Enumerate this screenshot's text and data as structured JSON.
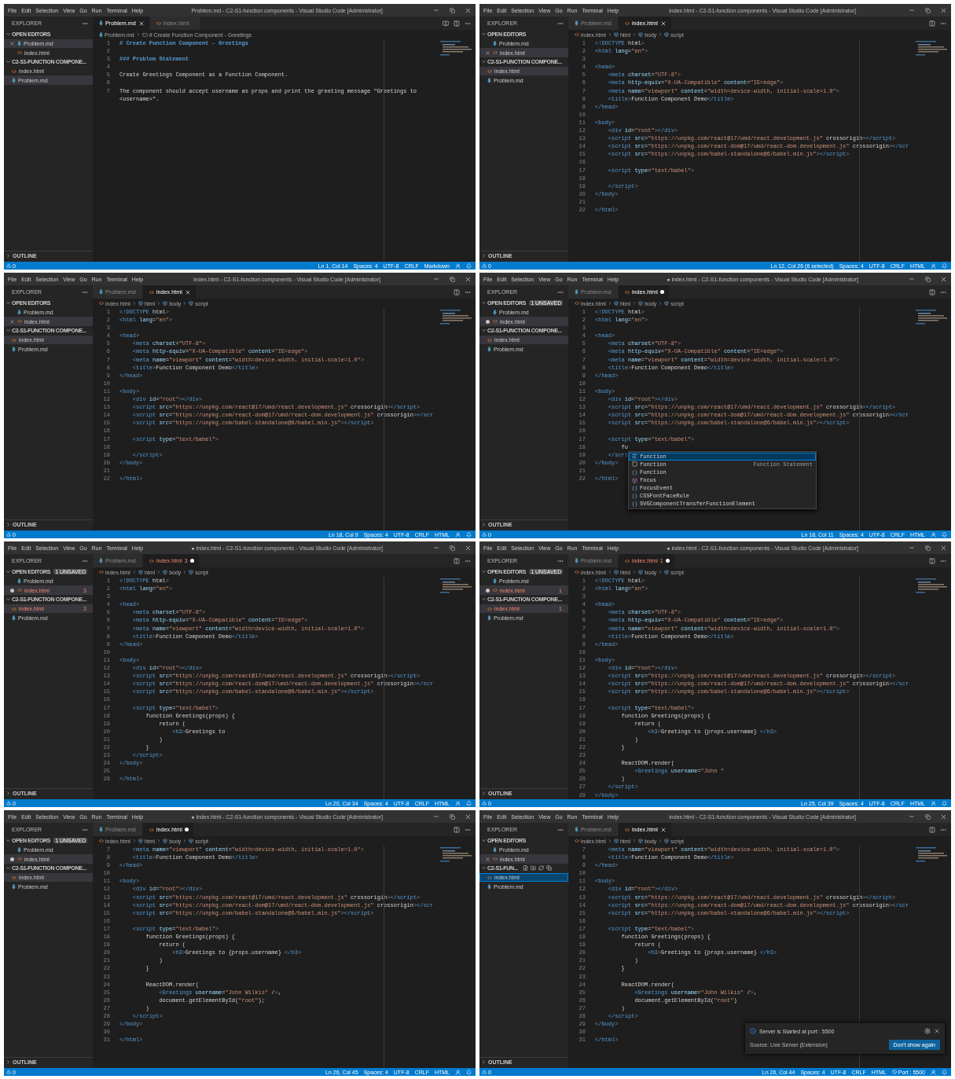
{
  "panels": [
    {
      "title": "Problem.md - C2-S1-function components - Visual Studio Code [Administrator]",
      "menu": [
        "File",
        "Edit",
        "Selection",
        "View",
        "Go",
        "Run",
        "Terminal",
        "Help"
      ],
      "explorer": {
        "heading": "EXPLORER",
        "open_editors": {
          "heading": "OPEN EDITORS",
          "items": [
            {
              "name": "Problem.md",
              "kind": "markdown",
              "selected": true,
              "dirty": false
            },
            {
              "name": "index.html",
              "kind": "html",
              "selected": false,
              "dirty": false
            }
          ]
        },
        "folder": {
          "heading": "C2-S1-FUNCTION COMPONE...",
          "focused": false,
          "files": [
            {
              "name": "index.html",
              "kind": "html",
              "selected": false
            },
            {
              "name": "Problem.md",
              "kind": "markdown",
              "selected": true
            }
          ]
        },
        "outline": "OUTLINE"
      },
      "tabs": [
        {
          "label": "Problem.md",
          "kind": "markdown",
          "selected": true,
          "dirty": false
        },
        {
          "label": "index.html",
          "kind": "html",
          "selected": false,
          "dirty": false
        }
      ],
      "breadcrumb": [
        {
          "label": "Problem.md",
          "kind": "markdown"
        },
        {
          "label": "# Create Function Component - Greetings",
          "kind": "heading"
        }
      ],
      "kind": "markdown",
      "lines": [
        {
          "n": "1",
          "code": "# Create Function Component - Greetings",
          "kind": "heading"
        },
        {
          "n": "2"
        },
        {
          "n": "3",
          "code": "### Problem Statement",
          "kind": "heading"
        },
        {
          "n": "4"
        },
        {
          "n": "5",
          "code": "Create Greetings Component as a Function Component.",
          "kind": "text"
        },
        {
          "n": "6"
        },
        {
          "n": "7",
          "code": "The component should accept username as props and print the greeting message \"Greetings to <username>\".",
          "kind": "text"
        }
      ],
      "status": {
        "problems": "0",
        "items": [
          {
            "text": "Ln 1, Col 14",
            "kind": "text"
          },
          {
            "text": "Spaces: 4",
            "kind": "text"
          },
          {
            "text": "UTF-8",
            "kind": "text"
          },
          {
            "text": "CRLF",
            "kind": "text"
          },
          {
            "text": "Markdown",
            "kind": "text"
          }
        ]
      }
    },
    {
      "title": "index.html - C2-S1-function components - Visual Studio Code [Administrator]",
      "menu": [
        "File",
        "Edit",
        "Selection",
        "View",
        "Go",
        "Run",
        "Terminal",
        "Help"
      ],
      "explorer": {
        "heading": "EXPLORER",
        "open_editors": {
          "heading": "OPEN EDITORS",
          "items": [
            {
              "name": "Problem.md",
              "kind": "markdown",
              "selected": false,
              "dirty": false
            },
            {
              "name": "index.html",
              "kind": "html",
              "selected": true,
              "dirty": false
            }
          ]
        },
        "folder": {
          "heading": "C2-S1-FUNCTION COMPONE...",
          "focused": false,
          "files": [
            {
              "name": "index.html",
              "kind": "html",
              "selected": true
            },
            {
              "name": "Problem.md",
              "kind": "markdown",
              "selected": false
            }
          ]
        },
        "outline": "OUTLINE"
      },
      "tabs": [
        {
          "label": "Problem.md",
          "kind": "markdown",
          "selected": false,
          "dirty": false
        },
        {
          "label": "index.html",
          "kind": "html",
          "selected": true,
          "dirty": false
        }
      ],
      "breadcrumb": [
        {
          "label": "index.html",
          "kind": "html"
        },
        {
          "label": "html",
          "kind": "element"
        },
        {
          "label": "body",
          "kind": "element"
        },
        {
          "label": "script",
          "kind": "element"
        }
      ],
      "kind": "html",
      "lines": [
        [
          "1",
          "<!DOCTYPE html>"
        ],
        [
          "2",
          "<html lang=\"en\">"
        ],
        [
          "3"
        ],
        [
          "4",
          "<head>"
        ],
        [
          "5",
          "    <meta charset=\"UTF-8\">"
        ],
        [
          "6",
          "    <meta http-equiv=\"X-UA-Compatible\" content=\"IE=edge\">"
        ],
        [
          "7",
          "    <meta name=\"viewport\" content=\"width=device-width, initial-scale=1.0\">"
        ],
        [
          "8",
          "    <title>Function Component Demo</title>"
        ],
        [
          "9",
          "</head>"
        ],
        [
          "10"
        ],
        [
          "11",
          "<body>"
        ],
        [
          "12",
          "    <div id=\"root\"></div>"
        ],
        [
          "13",
          "    <script src=\"https://unpkg.com/react@17/umd/react.development.js\" crossorigin></script>"
        ],
        [
          "14",
          "    <script src=\"https://unpkg.com/react-dom@17/umd/react-dom.development.js\" crossorigin></scr"
        ],
        [
          "15",
          "    <script src=\"https://unpkg.com/babel-standalone@6/babel.min.js\"></script>"
        ],
        [
          "16"
        ],
        [
          "17",
          "    <script type=\"text/babel\">"
        ],
        [
          "18"
        ],
        [
          "19",
          "    </script>"
        ],
        [
          "20",
          "</body>"
        ],
        [
          "21"
        ],
        [
          "22",
          "</html>"
        ]
      ],
      "status": {
        "problems": "0",
        "items": [
          {
            "text": "Ln 12, Col 26 (6 selected)",
            "kind": "text"
          },
          {
            "text": "Spaces: 4",
            "kind": "text"
          },
          {
            "text": "UTF-8",
            "kind": "text"
          },
          {
            "text": "CRLF",
            "kind": "text"
          },
          {
            "text": "HTML",
            "kind": "text"
          }
        ]
      }
    },
    {
      "title": "index.html - C2-S1-function components - Visual Studio Code [Administrator]",
      "menu": [
        "File",
        "Edit",
        "Selection",
        "View",
        "Go",
        "Run",
        "Terminal",
        "Help"
      ],
      "explorer": {
        "heading": "EXPLORER",
        "open_editors": {
          "heading": "OPEN EDITORS",
          "items": [
            {
              "name": "Problem.md",
              "kind": "markdown",
              "selected": false,
              "dirty": false
            },
            {
              "name": "index.html",
              "kind": "html",
              "selected": true,
              "dirty": false
            }
          ]
        },
        "folder": {
          "heading": "C2-S1-FUNCTION COMPONE...",
          "focused": false,
          "files": [
            {
              "name": "index.html",
              "kind": "html",
              "selected": true
            },
            {
              "name": "Problem.md",
              "kind": "markdown",
              "selected": false
            }
          ]
        },
        "outline": "OUTLINE"
      },
      "tabs": [
        {
          "label": "Problem.md",
          "kind": "markdown",
          "selected": false,
          "dirty": false
        },
        {
          "label": "index.html",
          "kind": "html",
          "selected": true,
          "dirty": false
        }
      ],
      "breadcrumb": [
        {
          "label": "index.html",
          "kind": "html"
        },
        {
          "label": "html",
          "kind": "element"
        },
        {
          "label": "body",
          "kind": "element"
        },
        {
          "label": "script",
          "kind": "element"
        }
      ],
      "kind": "html",
      "lines": [
        [
          "1",
          "<!DOCTYPE html>"
        ],
        [
          "2",
          "<html lang=\"en\">"
        ],
        [
          "3"
        ],
        [
          "4",
          "<head>"
        ],
        [
          "5",
          "    <meta charset=\"UTF-8\">"
        ],
        [
          "6",
          "    <meta http-equiv=\"X-UA-Compatible\" content=\"IE=edge\">"
        ],
        [
          "7",
          "    <meta name=\"viewport\" content=\"width=device-width, initial-scale=1.0\">"
        ],
        [
          "8",
          "    <title>Function Component Demo</title>"
        ],
        [
          "9",
          "</head>"
        ],
        [
          "10"
        ],
        [
          "11",
          "<body>"
        ],
        [
          "12",
          "    <div id=\"root\"></div>"
        ],
        [
          "13",
          "    <script src=\"https://unpkg.com/react@17/umd/react.development.js\" crossorigin></script>"
        ],
        [
          "14",
          "    <script src=\"https://unpkg.com/react-dom@17/umd/react-dom.development.js\" crossorigin></scr"
        ],
        [
          "15",
          "    <script src=\"https://unpkg.com/babel-standalone@6/babel.min.js\"></script>"
        ],
        [
          "16"
        ],
        [
          "17",
          "    <script type=\"text/babel\">"
        ],
        [
          "18"
        ],
        [
          "19",
          "    </script>"
        ],
        [
          "20",
          "</body>"
        ],
        [
          "21"
        ],
        [
          "22",
          "</html>"
        ]
      ],
      "status": {
        "problems": "0",
        "items": [
          {
            "text": "Ln 18, Col 9",
            "kind": "text"
          },
          {
            "text": "Spaces: 4",
            "kind": "text"
          },
          {
            "text": "UTF-8",
            "kind": "text"
          },
          {
            "text": "CRLF",
            "kind": "text"
          },
          {
            "text": "HTML",
            "kind": "text"
          }
        ]
      }
    },
    {
      "title": "● index.html - C2-S1-function components - Visual Studio Code [Administrator]",
      "menu": [
        "File",
        "Edit",
        "Selection",
        "View",
        "Go",
        "Run",
        "Terminal",
        "Help"
      ],
      "explorer": {
        "heading": "EXPLORER",
        "open_editors": {
          "heading": "OPEN EDITORS",
          "badge": "1 UNSAVED",
          "items": [
            {
              "name": "Problem.md",
              "kind": "markdown",
              "selected": false,
              "dirty": false
            },
            {
              "name": "index.html",
              "kind": "html",
              "selected": true,
              "dirty": true
            }
          ]
        },
        "folder": {
          "heading": "C2-S1-FUNCTION COMPONE...",
          "focused": false,
          "files": [
            {
              "name": "index.html",
              "kind": "html",
              "selected": true
            },
            {
              "name": "Problem.md",
              "kind": "markdown",
              "selected": false
            }
          ]
        },
        "outline": "OUTLINE"
      },
      "tabs": [
        {
          "label": "Problem.md",
          "kind": "markdown",
          "selected": false,
          "dirty": false
        },
        {
          "label": "index.html",
          "kind": "html",
          "selected": true,
          "dirty": true
        }
      ],
      "breadcrumb": [
        {
          "label": "index.html",
          "kind": "html"
        },
        {
          "label": "html",
          "kind": "element"
        },
        {
          "label": "body",
          "kind": "element"
        },
        {
          "label": "script",
          "kind": "element"
        }
      ],
      "kind": "html",
      "lines": [
        [
          "1",
          "<!DOCTYPE html>"
        ],
        [
          "2",
          "<html lang=\"en\">"
        ],
        [
          "3"
        ],
        [
          "4",
          "<head>"
        ],
        [
          "5",
          "    <meta charset=\"UTF-8\">"
        ],
        [
          "6",
          "    <meta http-equiv=\"X-UA-Compatible\" content=\"IE=edge\">"
        ],
        [
          "7",
          "    <meta name=\"viewport\" content=\"width=device-width, initial-scale=1.0\">"
        ],
        [
          "8",
          "    <title>Function Component Demo</title>"
        ],
        [
          "9",
          "</head>"
        ],
        [
          "10"
        ],
        [
          "11",
          "<body>"
        ],
        [
          "12",
          "    <div id=\"root\"></div>"
        ],
        [
          "13",
          "    <script src=\"https://unpkg.com/react@17/umd/react.development.js\" crossorigin></script>"
        ],
        [
          "14",
          "    <script src=\"https://unpkg.com/react-dom@17/umd/react-dom.development.js\" crossorigin></scr"
        ],
        [
          "15",
          "    <script src=\"https://unpkg.com/babel-standalone@6/babel.min.js\"></script>"
        ],
        [
          "16"
        ],
        [
          "17",
          "    <script type=\"text/babel\">"
        ],
        [
          "18",
          "        fu"
        ],
        [
          "19",
          "    </scri"
        ],
        [
          "20",
          "</body>"
        ],
        [
          "21"
        ],
        [
          "22",
          "</html>"
        ]
      ],
      "suggest": {
        "items": [
          {
            "label": "function",
            "kind": "snippet",
            "selected": true
          },
          {
            "label": "function",
            "kind": "keyword",
            "detail": "Function Statement",
            "selected": false
          },
          {
            "label": "Function",
            "kind": "variable",
            "selected": false
          },
          {
            "label": "focus",
            "kind": "method",
            "selected": false
          },
          {
            "label": "FocusEvent",
            "kind": "variable",
            "selected": false
          },
          {
            "label": "CSSFontFaceRule",
            "kind": "variable",
            "selected": false
          },
          {
            "label": "SVGComponentTransferFunctionElement",
            "kind": "variable",
            "selected": false
          }
        ]
      },
      "status": {
        "problems": "0",
        "items": [
          {
            "text": "Ln 18, Col 11",
            "kind": "text"
          },
          {
            "text": "Spaces: 4",
            "kind": "text"
          },
          {
            "text": "UTF-8",
            "kind": "text"
          },
          {
            "text": "CRLF",
            "kind": "text"
          },
          {
            "text": "HTML",
            "kind": "text"
          }
        ]
      }
    },
    {
      "title": "● index.html - C2-S1-function components - Visual Studio Code [Administrator]",
      "menu": [
        "File",
        "Edit",
        "Selection",
        "View",
        "Go",
        "Run",
        "Terminal",
        "Help"
      ],
      "explorer": {
        "heading": "EXPLORER",
        "open_editors": {
          "heading": "OPEN EDITORS",
          "badge": "1 UNSAVED",
          "items": [
            {
              "name": "Problem.md",
              "kind": "markdown",
              "selected": false,
              "dirty": false
            },
            {
              "name": "index.html",
              "kind": "html",
              "selected": true,
              "dirty": true,
              "errors": "3"
            }
          ]
        },
        "folder": {
          "heading": "C2-S1-FUNCTION COMPONE...",
          "focused": false,
          "files": [
            {
              "name": "index.html",
              "kind": "html",
              "selected": true,
              "errors": "3"
            },
            {
              "name": "Problem.md",
              "kind": "markdown",
              "selected": false
            }
          ]
        },
        "outline": "OUTLINE"
      },
      "tabs": [
        {
          "label": "Problem.md",
          "kind": "markdown",
          "selected": false,
          "dirty": false
        },
        {
          "label": "index.html",
          "kind": "html",
          "selected": true,
          "dirty": true,
          "errors": "3"
        }
      ],
      "breadcrumb": [
        {
          "label": "index.html",
          "kind": "html"
        },
        {
          "label": "html",
          "kind": "element"
        },
        {
          "label": "body",
          "kind": "element"
        },
        {
          "label": "script",
          "kind": "element"
        }
      ],
      "kind": "html",
      "lines": [
        [
          "1",
          "<!DOCTYPE html>"
        ],
        [
          "2",
          "<html lang=\"en\">"
        ],
        [
          "3"
        ],
        [
          "4",
          "<head>"
        ],
        [
          "5",
          "    <meta charset=\"UTF-8\">"
        ],
        [
          "6",
          "    <meta http-equiv=\"X-UA-Compatible\" content=\"IE=edge\">"
        ],
        [
          "7",
          "    <meta name=\"viewport\" content=\"width=device-width, initial-scale=1.0\">"
        ],
        [
          "8",
          "    <title>Function Component Demo</title>"
        ],
        [
          "9",
          "</head>"
        ],
        [
          "10"
        ],
        [
          "11",
          "<body>"
        ],
        [
          "12",
          "    <div id=\"root\"></div>"
        ],
        [
          "13",
          "    <script src=\"https://unpkg.com/react@17/umd/react.development.js\" crossorigin></script>"
        ],
        [
          "14",
          "    <script src=\"https://unpkg.com/react-dom@17/umd/react-dom.development.js\" crossorigin></scr"
        ],
        [
          "15",
          "    <script src=\"https://unpkg.com/babel-standalone@6/babel.min.js\"></script>"
        ],
        [
          "16"
        ],
        [
          "17",
          "    <script type=\"text/babel\">"
        ],
        [
          "18",
          "        function Greetings(props) {"
        ],
        [
          "19",
          "            return ("
        ],
        [
          "20",
          "                <h3>Greetings to"
        ],
        [
          "21",
          "            )"
        ],
        [
          "22",
          "        }"
        ],
        [
          "23",
          "    </script>"
        ],
        [
          "24",
          "</body>"
        ],
        [
          "25"
        ],
        [
          "26",
          "</html>"
        ]
      ],
      "status": {
        "problems": "0",
        "items": [
          {
            "text": "Ln 20, Col 34",
            "kind": "text"
          },
          {
            "text": "Spaces: 4",
            "kind": "text"
          },
          {
            "text": "UTF-8",
            "kind": "text"
          },
          {
            "text": "CRLF",
            "kind": "text"
          },
          {
            "text": "HTML",
            "kind": "text"
          }
        ]
      }
    },
    {
      "title": "● index.html - C2-S1-function components - Visual Studio Code [Administrator]",
      "menu": [
        "File",
        "Edit",
        "Selection",
        "View",
        "Go",
        "Run",
        "Terminal",
        "Help"
      ],
      "explorer": {
        "heading": "EXPLORER",
        "open_editors": {
          "heading": "OPEN EDITORS",
          "badge": "1 UNSAVED",
          "items": [
            {
              "name": "Problem.md",
              "kind": "markdown",
              "selected": false,
              "dirty": false
            },
            {
              "name": "index.html",
              "kind": "html",
              "selected": true,
              "dirty": true,
              "errors": "1"
            }
          ]
        },
        "folder": {
          "heading": "C2-S1-FUNCTION COMPONE...",
          "focused": false,
          "files": [
            {
              "name": "index.html",
              "kind": "html",
              "selected": true,
              "errors": "1"
            },
            {
              "name": "Problem.md",
              "kind": "markdown",
              "selected": false
            }
          ]
        },
        "outline": "OUTLINE"
      },
      "tabs": [
        {
          "label": "Problem.md",
          "kind": "markdown",
          "selected": false,
          "dirty": false
        },
        {
          "label": "index.html",
          "kind": "html",
          "selected": true,
          "dirty": true,
          "errors": "1"
        }
      ],
      "breadcrumb": [
        {
          "label": "index.html",
          "kind": "html"
        },
        {
          "label": "html",
          "kind": "element"
        },
        {
          "label": "body",
          "kind": "element"
        },
        {
          "label": "script",
          "kind": "element"
        }
      ],
      "kind": "html",
      "lines": [
        [
          "1",
          "<!DOCTYPE html>"
        ],
        [
          "2",
          "<html lang=\"en\">"
        ],
        [
          "3"
        ],
        [
          "4",
          "<head>"
        ],
        [
          "5",
          "    <meta charset=\"UTF-8\">"
        ],
        [
          "6",
          "    <meta http-equiv=\"X-UA-Compatible\" content=\"IE=edge\">"
        ],
        [
          "7",
          "    <meta name=\"viewport\" content=\"width=device-width, initial-scale=1.0\">"
        ],
        [
          "8",
          "    <title>Function Component Demo</title>"
        ],
        [
          "9",
          "</head>"
        ],
        [
          "10"
        ],
        [
          "11",
          "<body>"
        ],
        [
          "12",
          "    <div id=\"root\"></div>"
        ],
        [
          "13",
          "    <script src=\"https://unpkg.com/react@17/umd/react.development.js\" crossorigin></script>"
        ],
        [
          "14",
          "    <script src=\"https://unpkg.com/react-dom@17/umd/react-dom.development.js\" crossorigin></scr"
        ],
        [
          "15",
          "    <script src=\"https://unpkg.com/babel-standalone@6/babel.min.js\"></script>"
        ],
        [
          "16"
        ],
        [
          "17",
          "    <script type=\"text/babel\">"
        ],
        [
          "18",
          "        function Greetings(props) {"
        ],
        [
          "19",
          "            return ("
        ],
        [
          "20",
          "                <h3>Greetings to {props.username} </h3>"
        ],
        [
          "21",
          "            )"
        ],
        [
          "22",
          "        }"
        ],
        [
          "23"
        ],
        [
          "24",
          "        ReactDOM.render("
        ],
        [
          "25",
          "            <Greetings username=\"John \""
        ],
        [
          "26",
          "        )"
        ],
        [
          "27",
          "    </script>"
        ],
        [
          "28",
          "</body>"
        ]
      ],
      "status": {
        "problems": "0",
        "items": [
          {
            "text": "Ln 25, Col 39",
            "kind": "text"
          },
          {
            "text": "Spaces: 4",
            "kind": "text"
          },
          {
            "text": "UTF-8",
            "kind": "text"
          },
          {
            "text": "CRLF",
            "kind": "text"
          },
          {
            "text": "HTML",
            "kind": "text"
          }
        ]
      }
    },
    {
      "title": "● index.html - C2-S1-function components - Visual Studio Code [Administrator]",
      "menu": [
        "File",
        "Edit",
        "Selection",
        "View",
        "Go",
        "Run",
        "Terminal",
        "Help"
      ],
      "explorer": {
        "heading": "EXPLORER",
        "open_editors": {
          "heading": "OPEN EDITORS",
          "badge": "1 UNSAVED",
          "items": [
            {
              "name": "Problem.md",
              "kind": "markdown",
              "selected": false,
              "dirty": false
            },
            {
              "name": "index.html",
              "kind": "html",
              "selected": true,
              "dirty": true
            }
          ]
        },
        "folder": {
          "heading": "C2-S1-FUNCTION COMPONE...",
          "focused": false,
          "files": [
            {
              "name": "index.html",
              "kind": "html",
              "selected": true
            },
            {
              "name": "Problem.md",
              "kind": "markdown",
              "selected": false
            }
          ]
        },
        "outline": "OUTLINE"
      },
      "tabs": [
        {
          "label": "Problem.md",
          "kind": "markdown",
          "selected": false,
          "dirty": false
        },
        {
          "label": "index.html",
          "kind": "html",
          "selected": true,
          "dirty": true
        }
      ],
      "breadcrumb": [
        {
          "label": "index.html",
          "kind": "html"
        },
        {
          "label": "html",
          "kind": "element"
        },
        {
          "label": "body",
          "kind": "element"
        },
        {
          "label": "script",
          "kind": "element"
        }
      ],
      "kind": "html",
      "lines": [
        [
          "7",
          "    <meta name=\"viewport\" content=\"width=device-width, initial-scale=1.0\">"
        ],
        [
          "8",
          "    <title>Function Component Demo</title>"
        ],
        [
          "9",
          "</head>"
        ],
        [
          "10"
        ],
        [
          "11",
          "<body>"
        ],
        [
          "12",
          "    <div id=\"root\"></div>"
        ],
        [
          "13",
          "    <script src=\"https://unpkg.com/react@17/umd/react.development.js\" crossorigin></script>"
        ],
        [
          "14",
          "    <script src=\"https://unpkg.com/react-dom@17/umd/react-dom.development.js\" crossorigin></scr"
        ],
        [
          "15",
          "    <script src=\"https://unpkg.com/babel-standalone@6/babel.min.js\"></script>"
        ],
        [
          "16"
        ],
        [
          "17",
          "    <script type=\"text/babel\">"
        ],
        [
          "18",
          "        function Greetings(props) {"
        ],
        [
          "19",
          "            return ("
        ],
        [
          "20",
          "                <h3>Greetings to {props.username} </h3>"
        ],
        [
          "21",
          "            )"
        ],
        [
          "22",
          "        }"
        ],
        [
          "23"
        ],
        [
          "24",
          "        ReactDOM.render("
        ],
        [
          "25",
          "            <Greetings username=\"John Wilkis\" />,"
        ],
        [
          "26",
          "            document.getElementById(\"root\");"
        ],
        [
          "27",
          "        )"
        ],
        [
          "28",
          "    </script>"
        ],
        [
          "29",
          "</body>"
        ],
        [
          "30"
        ],
        [
          "31",
          "</html>"
        ]
      ],
      "status": {
        "problems": "0",
        "items": [
          {
            "text": "Ln 26, Col 45",
            "kind": "text"
          },
          {
            "text": "Spaces: 4",
            "kind": "text"
          },
          {
            "text": "UTF-8",
            "kind": "text"
          },
          {
            "text": "CRLF",
            "kind": "text"
          },
          {
            "text": "HTML",
            "kind": "text"
          }
        ]
      }
    },
    {
      "title": "index.html - C2-S1-function components - Visual Studio Code [Administrator]",
      "menu": [
        "File",
        "Edit",
        "Selection",
        "View",
        "Go",
        "Run",
        "Terminal",
        "Help"
      ],
      "explorer": {
        "heading": "EXPLORER",
        "open_editors": {
          "heading": "OPEN EDITORS",
          "items": [
            {
              "name": "Problem.md",
              "kind": "markdown",
              "selected": false,
              "dirty": false
            },
            {
              "name": "index.html",
              "kind": "html",
              "selected": true,
              "dirty": false
            }
          ]
        },
        "folder": {
          "heading": "C2-S1-FUN...",
          "focused": true,
          "files": [
            {
              "name": "index.html",
              "kind": "html",
              "selected": true
            },
            {
              "name": "Problem.md",
              "kind": "markdown",
              "selected": false
            }
          ]
        },
        "outline": "OUTLINE"
      },
      "tabs": [
        {
          "label": "Problem.md",
          "kind": "markdown",
          "selected": false,
          "dirty": false
        },
        {
          "label": "index.html",
          "kind": "html",
          "selected": true,
          "dirty": false
        }
      ],
      "breadcrumb": [
        {
          "label": "index.html",
          "kind": "html"
        },
        {
          "label": "html",
          "kind": "element"
        },
        {
          "label": "body",
          "kind": "element"
        },
        {
          "label": "script",
          "kind": "element"
        }
      ],
      "kind": "html",
      "lines": [
        [
          "7",
          "    <meta name=\"viewport\" content=\"width=device-width, initial-scale=1.0\">"
        ],
        [
          "8",
          "    <title>Function Component Demo</title>"
        ],
        [
          "9",
          "</head>"
        ],
        [
          "10"
        ],
        [
          "11",
          "<body>"
        ],
        [
          "12",
          "    <div id=\"root\"></div>"
        ],
        [
          "13",
          "    <script src=\"https://unpkg.com/react@17/umd/react.development.js\" crossorigin></script>"
        ],
        [
          "14",
          "    <script src=\"https://unpkg.com/react-dom@17/umd/react-dom.development.js\" crossorigin></scr"
        ],
        [
          "15",
          "    <script src=\"https://unpkg.com/babel-standalone@6/babel.min.js\"></script>"
        ],
        [
          "16"
        ],
        [
          "17",
          "    <script type=\"text/babel\">"
        ],
        [
          "18",
          "        function Greetings(props) {"
        ],
        [
          "19",
          "            return ("
        ],
        [
          "20",
          "                <h3>Greetings to {props.username} </h3>"
        ],
        [
          "21",
          "            )"
        ],
        [
          "22",
          "        }"
        ],
        [
          "23"
        ],
        [
          "24",
          "        ReactDOM.render("
        ],
        [
          "25",
          "            <Greetings username=\"John Wilkis\" />,"
        ],
        [
          "26",
          "            document.getElementById(\"root\")"
        ],
        [
          "27",
          "        )"
        ],
        [
          "28",
          "    </script>"
        ],
        [
          "29",
          "</body>"
        ],
        [
          "30"
        ],
        [
          "31",
          "</html>"
        ]
      ],
      "notification": {
        "message": "Server is Started at port : 5500",
        "source": "Source: Live Server (Extension)",
        "button": "Don't show again"
      },
      "status": {
        "problems": "0",
        "items": [
          {
            "text": "Ln 26, Col 44",
            "kind": "text"
          },
          {
            "text": "Spaces: 4",
            "kind": "text"
          },
          {
            "text": "UTF-8",
            "kind": "text"
          },
          {
            "text": "CRLF",
            "kind": "text"
          },
          {
            "text": "HTML",
            "kind": "text"
          },
          {
            "text": "Port : 5500",
            "kind": "port"
          }
        ]
      }
    }
  ]
}
